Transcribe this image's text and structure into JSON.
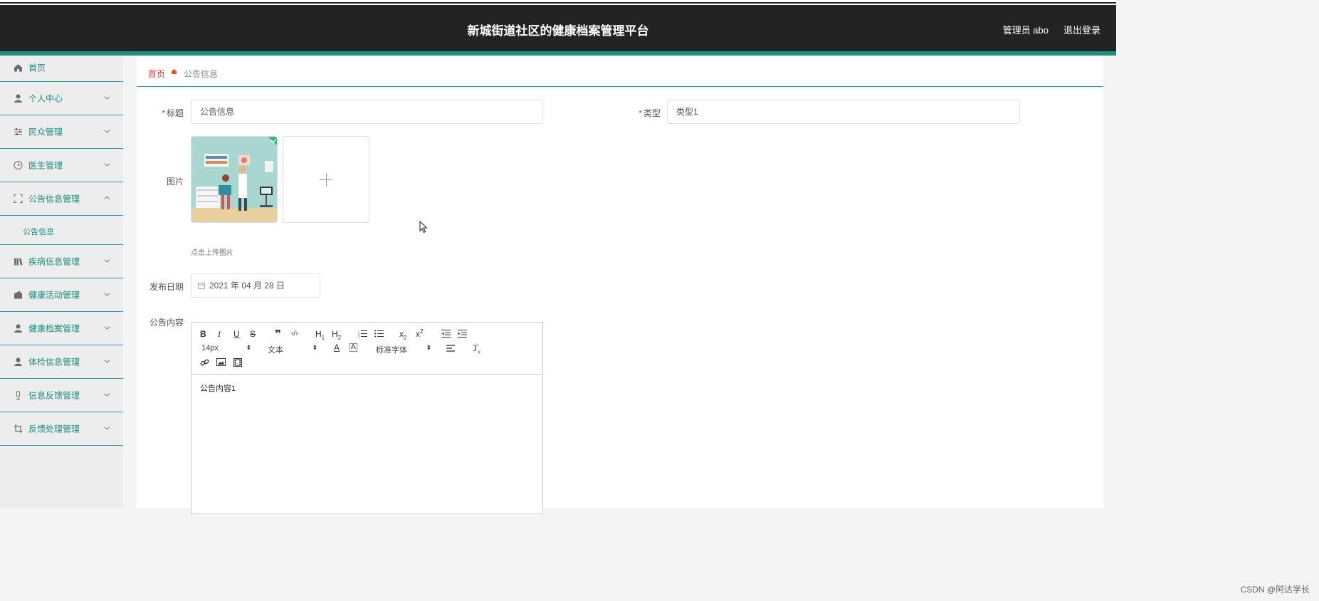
{
  "header": {
    "title": "新城街道社区的健康档案管理平台",
    "user": "管理员 abo",
    "logout": "退出登录"
  },
  "sidebar": {
    "items": [
      {
        "label": "首页",
        "icon": "home-icon"
      },
      {
        "label": "个人中心",
        "icon": "user-icon"
      },
      {
        "label": "民众管理",
        "icon": "sliders-icon"
      },
      {
        "label": "医生管理",
        "icon": "clock-icon"
      },
      {
        "label": "公告信息管理",
        "icon": "frame-icon",
        "expanded": true
      },
      {
        "label": "疾病信息管理",
        "icon": "books-icon"
      },
      {
        "label": "健康活动管理",
        "icon": "wallet-icon"
      },
      {
        "label": "健康档案管理",
        "icon": "user-icon"
      },
      {
        "label": "体检信息管理",
        "icon": "user-icon"
      },
      {
        "label": "信息反馈管理",
        "icon": "mic-icon"
      },
      {
        "label": "反馈处理管理",
        "icon": "crop-icon"
      }
    ],
    "submenu": {
      "label": "公告信息"
    }
  },
  "breadcrumb": {
    "home": "首页",
    "current": "公告信息"
  },
  "form": {
    "title_label": "标题",
    "title_value": "公告信息",
    "type_label": "类型",
    "type_value": "类型1",
    "image_label": "图片",
    "upload_hint": "点击上传图片",
    "date_label": "发布日期",
    "date_value": "2021 年 04 月 28 日",
    "content_label": "公告内容",
    "content_value": "公告内容1"
  },
  "editor": {
    "font_size": "14px",
    "block_type": "文本",
    "font_family": "标准字体"
  },
  "watermark": "CSDN @阿达学长",
  "colors": {
    "header_bg": "#232323",
    "accent": "#1f8f86",
    "required": "#e4393c"
  }
}
